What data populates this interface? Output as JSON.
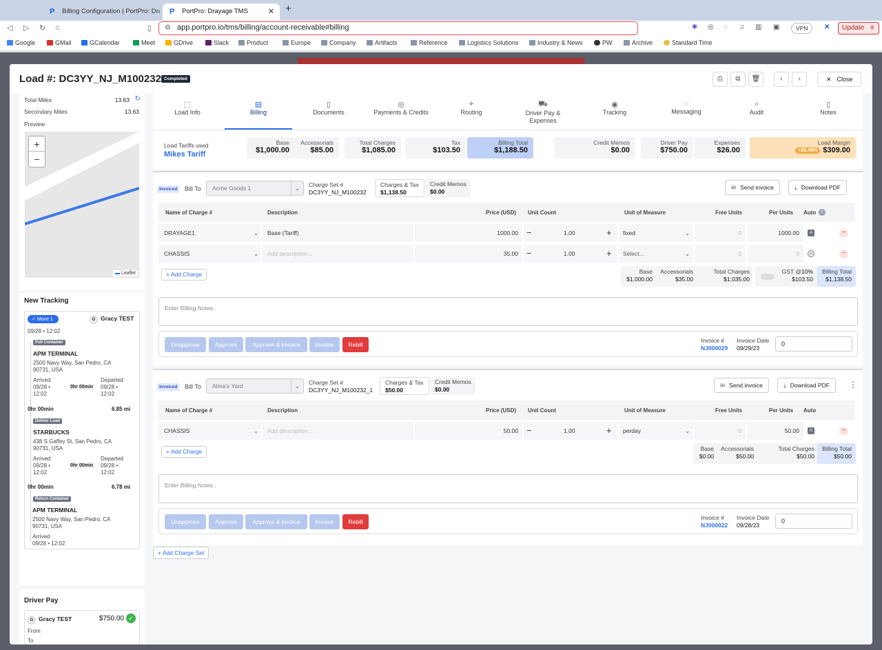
{
  "browser": {
    "tabs": [
      {
        "title": "Billing Configuration | PortPro: Dra..."
      },
      {
        "title": "PortPro: Drayage TMS"
      }
    ],
    "url": "app.portpro.io/tms/billing/account-receivable#billing",
    "vpn_label": "VPN",
    "update_label": "Update",
    "bookmarks": [
      "Google",
      "GMail",
      "GCalendar",
      "Meet",
      "GDrive",
      "Slack",
      "Product",
      "Europe",
      "Company",
      "Artifacts",
      "Reference",
      "Logistics Solutions",
      "Industry & News",
      "PW",
      "Archive",
      "Standard Time"
    ]
  },
  "modal": {
    "title": "Load #: DC3YY_NJ_M100232",
    "status": "Completed",
    "close_label": "Close"
  },
  "left": {
    "total_miles_label": "Total Miles",
    "total_miles": "13.63",
    "secondary_miles_label": "Secondary Miles",
    "secondary_miles": "13.63",
    "preview_label": "Preview",
    "map_zoom_in": "+",
    "map_zoom_out": "−",
    "leaflet_label": "Leaflet",
    "new_tracking_label": "New Tracking",
    "move_label": "Move 1",
    "driver_name": "Gracy TEST",
    "move_date": "09/28 • 12:02",
    "events": [
      {
        "badge": "Pull Container",
        "name": "APM TERMINAL",
        "addr1": "2500 Navy Way, San Pedro, CA",
        "addr2": "90731, USA",
        "arrived_label": "Arrived",
        "arrived": "09/28 •",
        "arrived_time": "12:02",
        "dur": "0hr 00min",
        "departed_label": "Departed",
        "departed": "09/28 •",
        "departed_time": "12:02",
        "leg_dur": "0hr 00min",
        "leg_miles": "6.85 mi"
      },
      {
        "badge": "Deliver Load",
        "name": "STARBUCKS",
        "addr1": "438 S Gaffey St, San Pedro, CA",
        "addr2": "90731, USA",
        "arrived_label": "Arrived",
        "arrived": "09/28 •",
        "arrived_time": "12:02",
        "dur": "0hr 00min",
        "departed_label": "Departed",
        "departed": "09/28 •",
        "departed_time": "12:02",
        "leg_dur": "0hr 00min",
        "leg_miles": "6.78 mi"
      },
      {
        "badge": "Return Container",
        "name": "APM TERMINAL",
        "addr1": "2500 Navy Way, San Pedro, CA",
        "addr2": "90731, USA",
        "arrived_label": "Arrived",
        "arrived": "09/28 • 12:02"
      }
    ],
    "driver_pay_label": "Driver Pay",
    "driver_pay_name": "Gracy TEST",
    "driver_pay_amount": "$750.00",
    "from_label": "From",
    "to_label": "To"
  },
  "nav_tabs": [
    "Load Info",
    "Billing",
    "Documents",
    "Payments & Credits",
    "Routing",
    "Driver Pay & Expenses",
    "Tracking",
    "Messaging",
    "Audit",
    "Notes"
  ],
  "summary": {
    "tariff_label": "Load Tariffs used",
    "tariff_name": "Mikes Tariff",
    "base_label": "Base",
    "base": "$1,000.00",
    "acc_label": "Accessorials",
    "acc": "$85.00",
    "total_label": "Total Charges",
    "total": "$1,085.00",
    "tax_label": "Tax",
    "tax": "$103.50",
    "bt_label": "Billing Total",
    "bt": "$1,188.50",
    "cm_label": "Credit Memos",
    "cm": "$0.00",
    "dp_label": "Driver Pay",
    "dp": "$750.00",
    "exp_label": "Expenses",
    "exp": "$26.00",
    "margin_label": "Load Margin",
    "margin_pct": "+28.48%",
    "margin": "$309.00"
  },
  "table_headers": {
    "name": "Name of Charge #",
    "desc": "Description",
    "price": "Price (USD)",
    "unit_count": "Unit Count",
    "uom": "Unit of Measure",
    "free": "Free Units",
    "per": "Per Units",
    "auto": "Auto"
  },
  "common": {
    "invoiced": "Invoiced",
    "bill_to": "Bill To",
    "charge_set_label": "Charge Set #",
    "charges_tax_label": "Charges & Tax",
    "credit_memos_label": "Credit Memos",
    "send_invoice": "Send invoice",
    "download_pdf": "Download PDF",
    "add_charge": "Add Charge",
    "notes_placeholder": "Enter Billing Notes..",
    "unapprove": "Unapprove",
    "approve": "Approve",
    "approve_invoice": "Approve & Invoice",
    "invoice": "Invoice",
    "rebill": "Rebill",
    "invoice_num_label": "Invoice #",
    "invoice_date_label": "Invoice Date",
    "add_charge_set": "Add Charge Set",
    "placeholder_desc": "Add description...",
    "placeholder_select": "Select...",
    "base_label": "Base",
    "acc_label": "Accessorials",
    "total_label": "Total Charges",
    "bt_label": "Billing Total"
  },
  "sets": [
    {
      "bill_to": "Acme Goods 1",
      "charge_set": "DC3YY_NJ_M100232",
      "charges_tax": "$1,138.50",
      "credit_memos": "$0.00",
      "rows": [
        {
          "name": "DRAYAGE1",
          "desc": "Base (Tariff)",
          "price": "1000.00",
          "count": "1.00",
          "uom": "fixed",
          "free": "0",
          "per": "1000.00",
          "auto": "A"
        },
        {
          "name": "CHASSIS",
          "desc": "",
          "price": "35.00",
          "count": "1.00",
          "uom": "",
          "free": "0",
          "per": "0",
          "auto": "M"
        }
      ],
      "totals": {
        "base": "$1,000.00",
        "acc": "$35.00",
        "total": "$1,035.00",
        "gst_label": "GST @",
        "gst_rate": "10%",
        "gst": "$103.50",
        "bt": "$1,138.50"
      },
      "invoice_num": "NJ000029",
      "invoice_date": "09/29/23",
      "input_val": "0"
    },
    {
      "bill_to": "Alma's Yard",
      "charge_set": "DC3YY_NJ_M100232_1",
      "charges_tax": "$50.00",
      "credit_memos": "$0.00",
      "rows": [
        {
          "name": "CHASSIS",
          "desc": "",
          "price": "50.00",
          "count": "1.00",
          "uom": "perday",
          "free": "0",
          "per": "50.00",
          "auto": "A"
        }
      ],
      "totals": {
        "base": "$0.00",
        "acc": "$50.00",
        "total": "$50.00",
        "bt": "$50.00"
      },
      "invoice_num": "NJ000022",
      "invoice_date": "09/28/23",
      "input_val": "0"
    }
  ]
}
